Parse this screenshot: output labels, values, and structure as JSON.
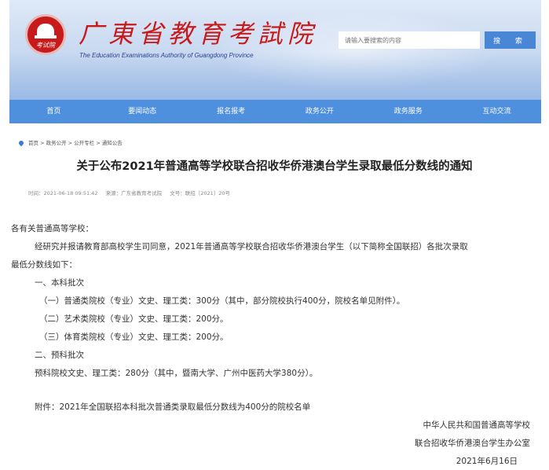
{
  "header": {
    "logo_text": "考试院",
    "site_title": "广東省教育考試院",
    "site_subtitle": "The Education Examinations Authority of Guangdong Province"
  },
  "search": {
    "placeholder": "请输入要搜索的内容",
    "button_label": "搜 索"
  },
  "nav": {
    "items": [
      "首页",
      "要闻动态",
      "报名报考",
      "政务公开",
      "政务服务",
      "互动交流"
    ]
  },
  "breadcrumb": "首页 > 政务公开 > 公开专栏 > 通知公告",
  "article": {
    "title": "关于公布2021年普通高等学校联合招收华侨港澳台学生录取最低分数线的通知",
    "meta": {
      "time": "时间：2021-06-18 09:51:42",
      "source": "来源：广东省教育考试院",
      "doc_no": "文号：联招〔2021〕20号"
    },
    "lines": [
      "各有关普通高等学校：",
      "经研究并报请教育部高校学生司同意，2021年普通高等学校联合招收华侨港澳台学生（以下简称全国联招）各批次录取",
      "最低分数线如下：",
      "一、本科批次",
      "（一）普通类院校（专业）文史、理工类：300分（其中，部分院校执行400分，院校名单见附件）。",
      "（二）艺术类院校（专业）文史、理工类：200分。",
      "（三）体育类院校（专业）文史、理工类：200分。",
      "二、预科批次",
      "预科院校文史、理工类：280分（其中，暨南大学、广州中医药大学380分）。",
      "附件：2021年全国联招本科批次普通类录取最低分数线为400分的院校名单"
    ],
    "signature": {
      "org1": "中华人民共和国普通高等学校",
      "org2": "联合招收华侨港澳台学生办公室",
      "date": "2021年6月16日"
    }
  }
}
